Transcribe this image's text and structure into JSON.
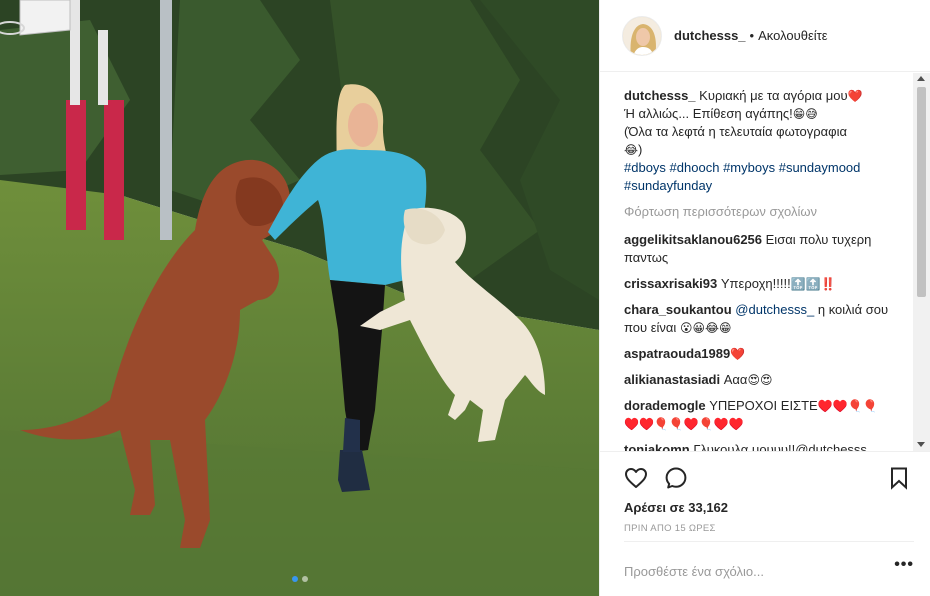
{
  "post": {
    "username": "dutchesss_",
    "follow_status": "Ακολουθείτε",
    "separator": "•",
    "caption": {
      "line1": "Κυριακή με τα αγόρια μου",
      "heart": "❤️",
      "line2": "Ή αλλιώς... Επίθεση αγάπης!",
      "line2_emoji": "😁😅",
      "line3": "(Όλα τα λεφτά η τελευταία φωτογραφια",
      "line3_emoji": "😂",
      "line3_end": ")",
      "hashtags": [
        "#dboys",
        "#dhooch",
        "#myboys",
        "#sundaymood",
        "#sundayfunday"
      ]
    },
    "load_more": "Φόρτωση περισσότερων σχολίων",
    "comments": [
      {
        "user": "aggelikitsaklanou6256",
        "text": "Εισαι πολυ τυχερη παντως"
      },
      {
        "user": "crissaxrisaki93",
        "text": "Υπεροχη!!!!!",
        "emoji": "🔝🔝‼️"
      },
      {
        "user": "chara_soukantou",
        "mention": "@dutchesss_",
        "text": "η κοιλιά σου που είναι",
        "emoji": "😮😀😂😁"
      },
      {
        "user": "aspatraouda1989",
        "emoji": "❤️"
      },
      {
        "user": "alikianastasiadi",
        "text": "Ααα",
        "emoji": "😍😍"
      },
      {
        "user": "dorademogle",
        "text": "ΥΠΕΡΟΧΟΙ ΕΙΣΤΕ",
        "emoji": "♥️♥️🎈🎈♥️♥️🎈🎈♥️🎈♥️♥️"
      },
      {
        "user": "toniakomn",
        "text": "Γλυκουλα μουυυ!!@dutchesss_",
        "emoji": "😍😍😍❤️❤️❤️🖤🖤🖤🖤"
      }
    ],
    "likes": "Αρέσει σε 33,162",
    "time": "ΠΡΙΝ ΑΠΟ 15 ΩΡΕΣ",
    "comment_placeholder": "Προσθέστε ένα σχόλιο...",
    "more_options": "•••"
  },
  "icons": {
    "like": "heart-outline-icon",
    "comment": "comment-bubble-icon",
    "save": "bookmark-icon",
    "options": "more-options-icon"
  },
  "colors": {
    "link": "#003569",
    "muted": "#999999",
    "text": "#262626",
    "border": "#efefef",
    "carousel_active": "#3897f0"
  },
  "carousel": {
    "count": 2,
    "active": 1
  }
}
